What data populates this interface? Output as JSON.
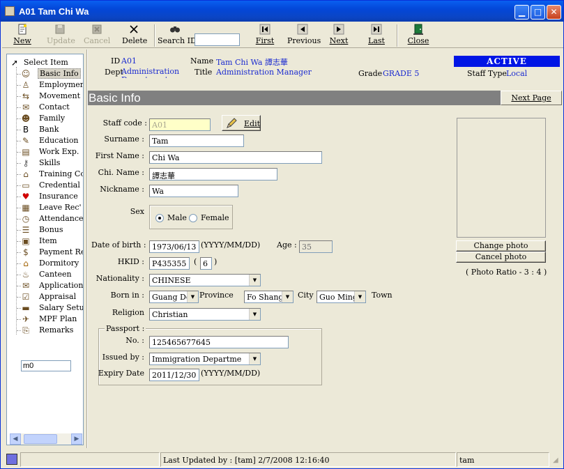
{
  "window": {
    "title": "A01 Tam Chi Wa"
  },
  "toolbar": {
    "new": "New",
    "update": "Update",
    "cancel": "Cancel",
    "delete": "Delete",
    "search_id": "Search ID",
    "first": "First",
    "previous": "Previous",
    "next": "Next",
    "last": "Last",
    "close": "Close"
  },
  "sidebar": {
    "root": "Select Item",
    "items": [
      {
        "label": "Basic Info",
        "icon": "person-icon"
      },
      {
        "label": "Employment",
        "icon": "employment-icon"
      },
      {
        "label": "Movement",
        "icon": "movement-icon"
      },
      {
        "label": "Contact",
        "icon": "contact-icon"
      },
      {
        "label": "Family",
        "icon": "family-icon"
      },
      {
        "label": "Bank",
        "icon": "bank-icon"
      },
      {
        "label": "Education",
        "icon": "education-icon"
      },
      {
        "label": "Work Exp.",
        "icon": "document-icon"
      },
      {
        "label": "Skills",
        "icon": "skills-icon"
      },
      {
        "label": "Training Cou",
        "icon": "training-icon"
      },
      {
        "label": "Credential",
        "icon": "credential-icon"
      },
      {
        "label": "Insurance",
        "icon": "heart-icon"
      },
      {
        "label": "Leave Rec'",
        "icon": "calendar-icon"
      },
      {
        "label": "Attendance",
        "icon": "clock-icon"
      },
      {
        "label": "Bonus",
        "icon": "bonus-icon"
      },
      {
        "label": "Item",
        "icon": "item-icon"
      },
      {
        "label": "Payment Rec'",
        "icon": "payment-icon"
      },
      {
        "label": "Dormitory",
        "icon": "house-icon"
      },
      {
        "label": "Canteen",
        "icon": "canteen-icon"
      },
      {
        "label": "Application",
        "icon": "application-icon"
      },
      {
        "label": "Appraisal",
        "icon": "checklist-icon"
      },
      {
        "label": "Salary Setup",
        "icon": "salary-icon"
      },
      {
        "label": "MPF Plan",
        "icon": "mpf-icon"
      },
      {
        "label": "Remarks",
        "icon": "paperclip-icon"
      }
    ],
    "input_value": "m0"
  },
  "header": {
    "id_label": "ID",
    "id_value": "A01",
    "dept_label": "Dept",
    "dept_value": "Administration Department",
    "name_label": "Name",
    "name_value": "Tam Chi Wa  譚志華",
    "title_label": "Title",
    "title_value": "Administration Manager",
    "grade_label": "Grade",
    "grade_value": "GRADE 5",
    "status": "ACTIVE",
    "staff_type_label": "Staff Type",
    "staff_type_value": "Local"
  },
  "section": {
    "title": "Basic Info",
    "next_page": "Next Page"
  },
  "form": {
    "staff_code_label": "Staff code :",
    "staff_code": "A01",
    "edit_button": "Edit",
    "surname_label": "Surname :",
    "surname": "Tam",
    "first_name_label": "First Name :",
    "first_name": "Chi Wa",
    "chi_name_label": "Chi. Name :",
    "chi_name": "譚志華",
    "nickname_label": "Nickname :",
    "nickname": "Wa",
    "sex_label": "Sex",
    "sex_male": "Male",
    "sex_female": "Female",
    "sex_selected": "Male",
    "dob_label": "Date of birth :",
    "dob": "1973/06/13",
    "dob_format": "(YYYY/MM/DD)",
    "age_label": "Age :",
    "age": "35",
    "hkid_label": "HKID :",
    "hkid": "P435355",
    "hkid_check": "6",
    "hkid_open": "(",
    "hkid_close": ")",
    "nationality_label": "Nationality :",
    "nationality": "CHINESE",
    "born_in_label": "Born in :",
    "province": "Guang Do:",
    "province_label": "Province",
    "city": "Fo Shang",
    "city_label": "City",
    "town": "Guo Ming",
    "town_label": "Town",
    "religion_label": "Religion",
    "religion": "Christian",
    "passport_label": "Passport :",
    "passport_no_label": "No. :",
    "passport_no": "125465677645",
    "issued_by_label": "Issued by :",
    "issued_by": "Immigration Departme",
    "expiry_label": "Expiry Date",
    "expiry": "2011/12/30",
    "expiry_format": "(YYYY/MM/DD)"
  },
  "photo": {
    "change": "Change photo",
    "cancel": "Cancel photo",
    "ratio": "( Photo Ratio - 3 : 4 )"
  },
  "status": {
    "last_updated": "Last Updated by : [tam]  2/7/2008 12:16:40",
    "user": "tam"
  },
  "colors": {
    "title_bar": "#0a5ff0",
    "active_badge": "#0015e5",
    "section_bar": "#808080"
  }
}
